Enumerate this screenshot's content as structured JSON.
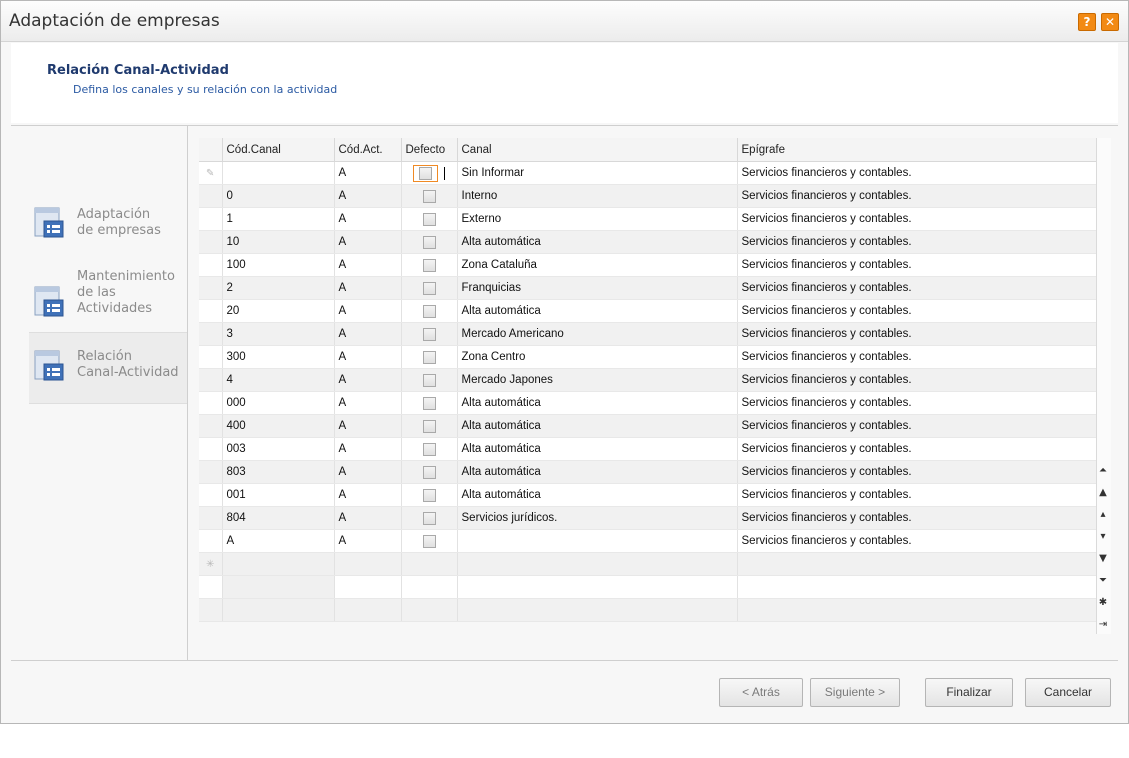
{
  "window": {
    "title": "Adaptación de empresas"
  },
  "header": {
    "title": "Relación Canal-Actividad",
    "subtitle": "Defina los canales y su relación con la actividad"
  },
  "sidebar": {
    "items": [
      {
        "label_1": "Adaptación",
        "label_2": "de empresas",
        "label_3": ""
      },
      {
        "label_1": "Mantenimiento",
        "label_2": "de las",
        "label_3": "Actividades"
      },
      {
        "label_1": "Relación",
        "label_2": "Canal-Actividad",
        "label_3": ""
      }
    ]
  },
  "grid": {
    "columns": [
      "Cód.Canal",
      "Cód.Act.",
      "Defecto",
      "Canal",
      "Epígrafe"
    ],
    "rows": [
      {
        "cod_canal": "",
        "cod_act": "A",
        "canal": "Sin Informar",
        "epigrafe": "Servicios financieros y contables."
      },
      {
        "cod_canal": "0",
        "cod_act": "A",
        "canal": "Interno",
        "epigrafe": "Servicios financieros y contables."
      },
      {
        "cod_canal": "1",
        "cod_act": "A",
        "canal": "Externo",
        "epigrafe": "Servicios financieros y contables."
      },
      {
        "cod_canal": "10",
        "cod_act": "A",
        "canal": "Alta automática",
        "epigrafe": "Servicios financieros y contables."
      },
      {
        "cod_canal": "100",
        "cod_act": "A",
        "canal": "Zona Cataluña",
        "epigrafe": "Servicios financieros y contables."
      },
      {
        "cod_canal": "2",
        "cod_act": "A",
        "canal": "Franquicias",
        "epigrafe": "Servicios financieros y contables."
      },
      {
        "cod_canal": "20",
        "cod_act": "A",
        "canal": "Alta automática",
        "epigrafe": "Servicios financieros y contables."
      },
      {
        "cod_canal": "3",
        "cod_act": "A",
        "canal": "Mercado Americano",
        "epigrafe": "Servicios financieros y contables."
      },
      {
        "cod_canal": "300",
        "cod_act": "A",
        "canal": "Zona Centro",
        "epigrafe": "Servicios financieros y contables."
      },
      {
        "cod_canal": "4",
        "cod_act": "A",
        "canal": "Mercado Japones",
        "epigrafe": "Servicios financieros y contables."
      },
      {
        "cod_canal": "000",
        "cod_act": "A",
        "canal": "Alta automática",
        "epigrafe": "Servicios financieros y contables."
      },
      {
        "cod_canal": "400",
        "cod_act": "A",
        "canal": "Alta automática",
        "epigrafe": "Servicios financieros y contables."
      },
      {
        "cod_canal": "003",
        "cod_act": "A",
        "canal": "Alta automática",
        "epigrafe": "Servicios financieros y contables."
      },
      {
        "cod_canal": "803",
        "cod_act": "A",
        "canal": "Alta automática",
        "epigrafe": "Servicios financieros y contables."
      },
      {
        "cod_canal": "001",
        "cod_act": "A",
        "canal": "Alta automática",
        "epigrafe": "Servicios financieros y contables."
      },
      {
        "cod_canal": "804",
        "cod_act": "A",
        "canal": "Servicios jurídicos.",
        "epigrafe": "Servicios financieros y contables."
      },
      {
        "cod_canal": "A",
        "cod_act": "A",
        "canal": "",
        "epigrafe": "Servicios financieros y contables."
      }
    ],
    "new_row_marker": "✳",
    "edit_row_marker": "✎"
  },
  "navigator": [
    "⏶",
    "▲",
    "▴",
    "▾",
    "▼",
    "⏷",
    "✱",
    "⇥"
  ],
  "footer": {
    "back": "< Atrás",
    "next": "Siguiente >",
    "finish": "Finalizar",
    "cancel": "Cancelar"
  },
  "colors": {
    "header_title": "#1f3a6e",
    "header_subtitle": "#2b5aa3",
    "title_button": "#f28a14",
    "focus": "#f08a24"
  }
}
